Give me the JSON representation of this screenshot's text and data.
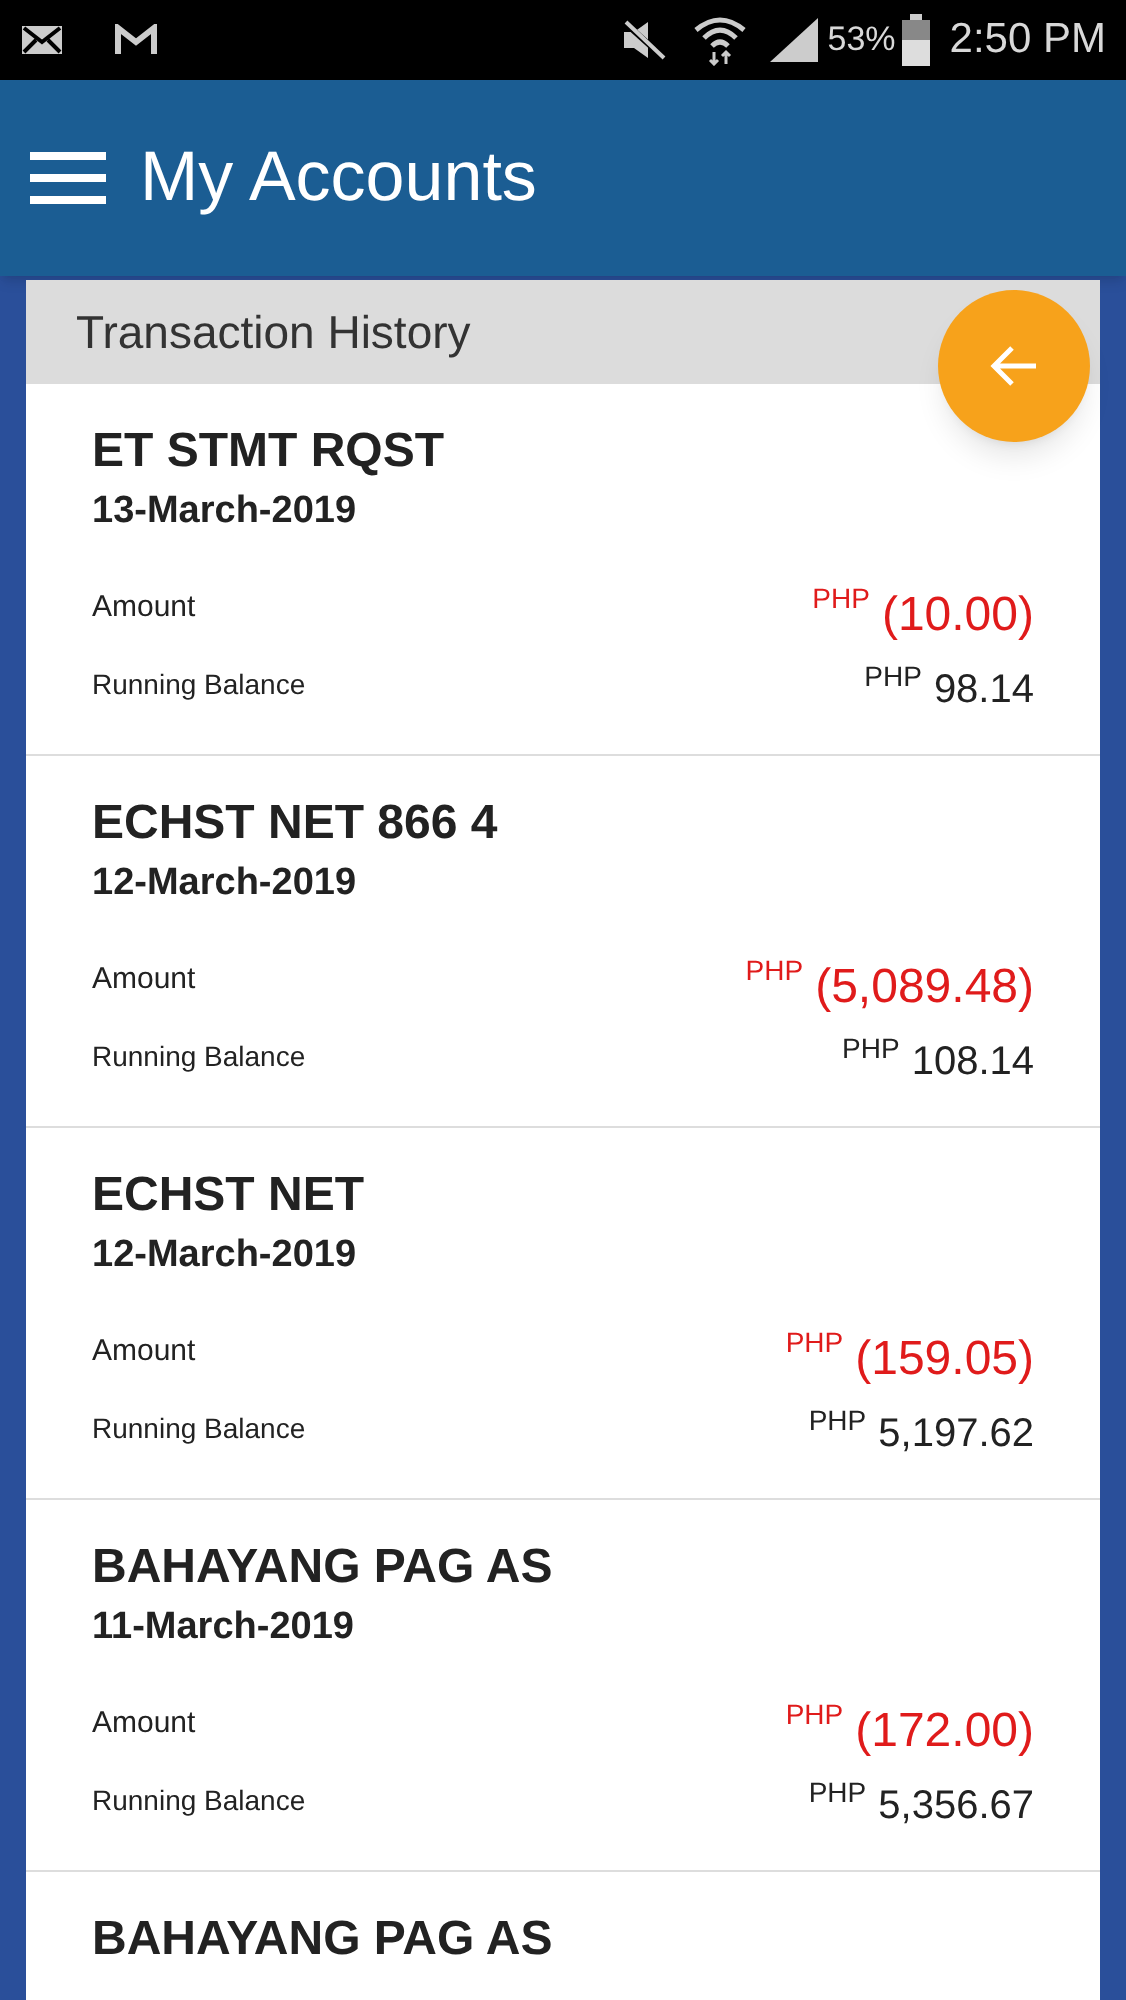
{
  "status_bar": {
    "battery": "53%",
    "time": "2:50 PM"
  },
  "app_bar": {
    "title": "My Accounts"
  },
  "section": {
    "title": "Transaction History"
  },
  "transactions": [
    {
      "description": "ET STMT RQST",
      "date": "13-March-2019",
      "amount_label": "Amount",
      "amount_currency": "PHP",
      "amount": "(10.00)",
      "balance_label": "Running Balance",
      "balance_currency": "PHP",
      "balance": "98.14"
    },
    {
      "description": "ECHST NET 866 4",
      "date": "12-March-2019",
      "amount_label": "Amount",
      "amount_currency": "PHP",
      "amount": "(5,089.48)",
      "balance_label": "Running Balance",
      "balance_currency": "PHP",
      "balance": "108.14"
    },
    {
      "description": "ECHST NET",
      "date": "12-March-2019",
      "amount_label": "Amount",
      "amount_currency": "PHP",
      "amount": "(159.05)",
      "balance_label": "Running Balance",
      "balance_currency": "PHP",
      "balance": "5,197.62"
    },
    {
      "description": "BAHAYANG PAG AS",
      "date": "11-March-2019",
      "amount_label": "Amount",
      "amount_currency": "PHP",
      "amount": "(172.00)",
      "balance_label": "Running Balance",
      "balance_currency": "PHP",
      "balance": "5,356.67"
    },
    {
      "description": "BAHAYANG PAG AS"
    }
  ]
}
